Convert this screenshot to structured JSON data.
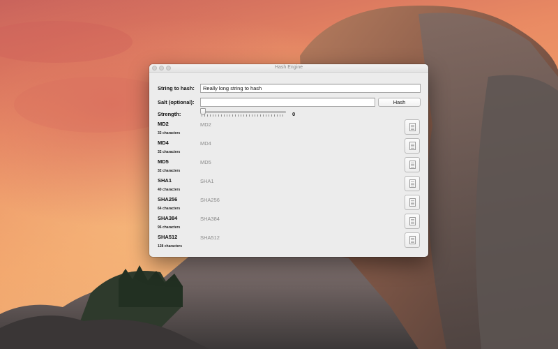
{
  "window": {
    "title": "Hash Engine"
  },
  "form": {
    "string_label": "String to hash:",
    "string_value": "Really long string to hash",
    "salt_label": "Salt (optional):",
    "salt_value": "",
    "hash_button": "Hash",
    "strength_label": "Strength:",
    "strength_value": "0"
  },
  "hashes": [
    {
      "name": "MD2",
      "length": "32 characters",
      "result": "MD2"
    },
    {
      "name": "MD4",
      "length": "32 characters",
      "result": "MD4"
    },
    {
      "name": "MD5",
      "length": "32 characters",
      "result": "MD5"
    },
    {
      "name": "SHA1",
      "length": "40 characters",
      "result": "SHA1"
    },
    {
      "name": "SHA256",
      "length": "64 characters",
      "result": "SHA256"
    },
    {
      "name": "SHA384",
      "length": "96 characters",
      "result": "SHA384"
    },
    {
      "name": "SHA512",
      "length": "128 characters",
      "result": "SHA512"
    }
  ],
  "icons": {
    "copy": "document-copy-icon"
  }
}
